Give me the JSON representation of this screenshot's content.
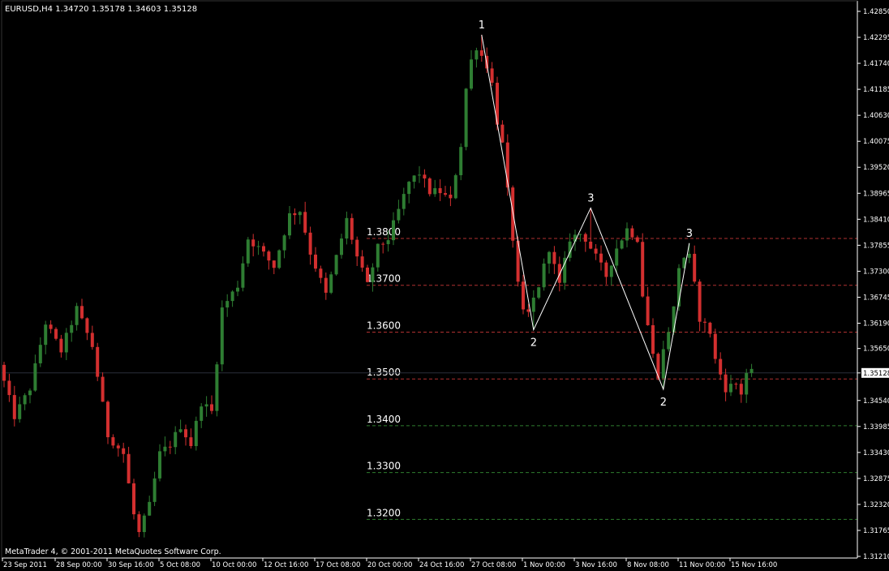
{
  "header": {
    "symbol_info": "EURUSD,H4  1.34720 1.35178 1.34603 1.35128"
  },
  "footer": {
    "copyright": "MetaTrader 4, © 2001-2011 MetaQuotes Software Corp."
  },
  "colors": {
    "background": "#000000",
    "bull_candle": "#2e7d32",
    "bear_candle": "#d32f2f",
    "axis": "#ffffff",
    "resistance_lines": "#b03030",
    "support_lines": "#2f7d2f",
    "wave_line": "#ffffff",
    "current_price_line": "#2a2f3a"
  },
  "chart_data": {
    "type": "candlestick",
    "symbol": "EURUSD",
    "timeframe": "H4",
    "ylim": [
      1.3121,
      1.4285
    ],
    "current_price": 1.35128,
    "y_tick_labels": [
      "1.42850",
      "1.42295",
      "1.41740",
      "1.41185",
      "1.40630",
      "1.40075",
      "1.39520",
      "1.38965",
      "1.38410",
      "1.37855",
      "1.37300",
      "1.36745",
      "1.36190",
      "1.35650",
      "1.35128",
      "1.34540",
      "1.33985",
      "1.33430",
      "1.32875",
      "1.32320",
      "1.31765",
      "1.31210"
    ],
    "x_tick_labels": [
      "23 Sep 2011",
      "28 Sep 00:00",
      "30 Sep 16:00",
      "5 Oct 08:00",
      "10 Oct 00:00",
      "12 Oct 16:00",
      "17 Oct 08:00",
      "20 Oct 00:00",
      "24 Oct 16:00",
      "27 Oct 08:00",
      "1 Nov 00:00",
      "3 Nov 16:00",
      "8 Nov 08:00",
      "11 Nov 00:00",
      "15 Nov 16:00"
    ],
    "bar_start_date": "2011-09-23",
    "bar_interval_hours": 4,
    "bar_count": 145,
    "horizontal_levels": [
      {
        "label": "1.3800",
        "price": 1.38,
        "kind": "resistance"
      },
      {
        "label": "1.3700",
        "price": 1.37,
        "kind": "resistance"
      },
      {
        "label": "1.3600",
        "price": 1.36,
        "kind": "resistance"
      },
      {
        "label": "1.3500",
        "price": 1.35,
        "kind": "resistance"
      },
      {
        "label": "1.3400",
        "price": 1.34,
        "kind": "support"
      },
      {
        "label": "1.3300",
        "price": 1.33,
        "kind": "support"
      },
      {
        "label": "1.3200",
        "price": 1.32,
        "kind": "support"
      }
    ],
    "wave_points": [
      {
        "label": "1",
        "bar": 92,
        "price": 1.4235
      },
      {
        "label": "2",
        "bar": 102,
        "price": 1.3605
      },
      {
        "label": "3",
        "bar": 113,
        "price": 1.3865
      },
      {
        "label": "2",
        "bar": 127,
        "price": 1.3478
      },
      {
        "label": "3",
        "bar": 132,
        "price": 1.379
      }
    ],
    "price_anchors": [
      [
        0,
        1.353
      ],
      [
        3,
        1.342
      ],
      [
        6,
        1.348
      ],
      [
        9,
        1.362
      ],
      [
        12,
        1.356
      ],
      [
        15,
        1.365
      ],
      [
        18,
        1.357
      ],
      [
        21,
        1.338
      ],
      [
        24,
        1.334
      ],
      [
        26,
        1.321
      ],
      [
        27,
        1.317
      ],
      [
        29,
        1.323
      ],
      [
        31,
        1.334
      ],
      [
        33,
        1.336
      ],
      [
        35,
        1.34
      ],
      [
        37,
        1.336
      ],
      [
        39,
        1.345
      ],
      [
        41,
        1.343
      ],
      [
        43,
        1.365
      ],
      [
        46,
        1.37
      ],
      [
        48,
        1.38
      ],
      [
        50,
        1.378
      ],
      [
        53,
        1.374
      ],
      [
        56,
        1.385
      ],
      [
        58,
        1.386
      ],
      [
        60,
        1.377
      ],
      [
        63,
        1.368
      ],
      [
        65,
        1.376
      ],
      [
        67,
        1.384
      ],
      [
        69,
        1.376
      ],
      [
        71,
        1.37
      ],
      [
        73,
        1.378
      ],
      [
        75,
        1.38
      ],
      [
        77,
        1.386
      ],
      [
        79,
        1.392
      ],
      [
        81,
        1.394
      ],
      [
        83,
        1.39
      ],
      [
        85,
        1.39
      ],
      [
        87,
        1.388
      ],
      [
        89,
        1.4
      ],
      [
        90,
        1.412
      ],
      [
        91,
        1.418
      ],
      [
        92,
        1.421
      ],
      [
        94,
        1.417
      ],
      [
        95,
        1.413
      ],
      [
        96,
        1.405
      ],
      [
        97,
        1.4
      ],
      [
        98,
        1.39
      ],
      [
        99,
        1.38
      ],
      [
        100,
        1.37
      ],
      [
        101,
        1.364
      ],
      [
        102,
        1.364
      ],
      [
        104,
        1.37
      ],
      [
        106,
        1.378
      ],
      [
        108,
        1.37
      ],
      [
        110,
        1.38
      ],
      [
        112,
        1.381
      ],
      [
        113,
        1.38
      ],
      [
        115,
        1.376
      ],
      [
        117,
        1.372
      ],
      [
        119,
        1.378
      ],
      [
        121,
        1.382
      ],
      [
        123,
        1.38
      ],
      [
        124,
        1.368
      ],
      [
        126,
        1.355
      ],
      [
        127,
        1.351
      ],
      [
        128,
        1.356
      ],
      [
        130,
        1.365
      ],
      [
        131,
        1.374
      ],
      [
        132,
        1.376
      ],
      [
        133,
        1.376
      ],
      [
        134,
        1.37
      ],
      [
        135,
        1.363
      ],
      [
        137,
        1.36
      ],
      [
        138,
        1.354
      ],
      [
        140,
        1.348
      ],
      [
        142,
        1.349
      ],
      [
        143,
        1.347
      ],
      [
        144,
        1.3513
      ]
    ]
  }
}
